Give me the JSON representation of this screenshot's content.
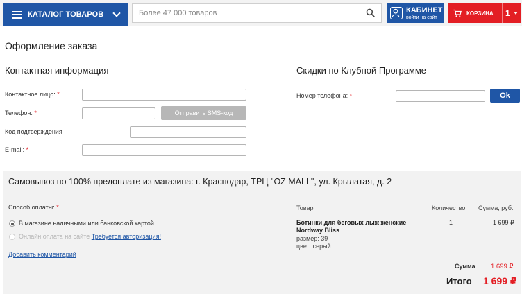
{
  "header": {
    "catalog_label": "КАТАЛОГ ТОВАРОВ",
    "search_placeholder": "Более 47 000 товаров",
    "cabinet_title": "КАБИНЕТ",
    "cabinet_sub": "войти на сайт",
    "cart_label": "КОРЗИНА",
    "cart_count": "1"
  },
  "page_title": "Оформление заказа",
  "contact": {
    "title": "Контактная информация",
    "fields": {
      "contact_person": {
        "label": "Контактное лицо:",
        "required": "*"
      },
      "phone": {
        "label": "Телефон:",
        "required": "*"
      },
      "sms_button": "Отправить SMS-код",
      "confirm_code": {
        "label": "Код подтверждения",
        "required": ""
      },
      "email": {
        "label": "E-mail:",
        "required": "*"
      }
    }
  },
  "club": {
    "title": "Скидки по Клубной Программе",
    "phone_label": "Номер телефона:",
    "required": "*",
    "ok_button": "Ok"
  },
  "pickup": {
    "title": "Самовывоз по 100% предоплате из магазина: г. Краснодар, ТРЦ \"OZ MALL\", ул. Крылатая, д. 2",
    "payment_label": "Способ оплаты:",
    "required": "*",
    "options": [
      {
        "label": "В магазине наличными или банковской картой",
        "checked": true,
        "disabled": false
      },
      {
        "label": "Онлайн оплата на сайте",
        "link": "Требуется авторизация!",
        "checked": false,
        "disabled": true
      }
    ],
    "add_comment": "Добавить комментарий"
  },
  "order_table": {
    "headers": {
      "product": "Товар",
      "quantity": "Количество",
      "sum": "Сумма, руб."
    },
    "rows": [
      {
        "name": "Ботинки для беговых лыж женские Nordway Bliss",
        "size": "размер: 39",
        "color": "цвет: серый",
        "quantity": "1",
        "sum": "1 699 ₽"
      }
    ],
    "subtotal_label": "Сумма",
    "subtotal_value": "1 699 ₽",
    "total_label": "Итого",
    "total_value": "1 699 ₽"
  },
  "colors": {
    "brand_blue": "#1f56a6",
    "accent_red": "#e31e24",
    "disabled_gray": "#b7b7b7"
  }
}
